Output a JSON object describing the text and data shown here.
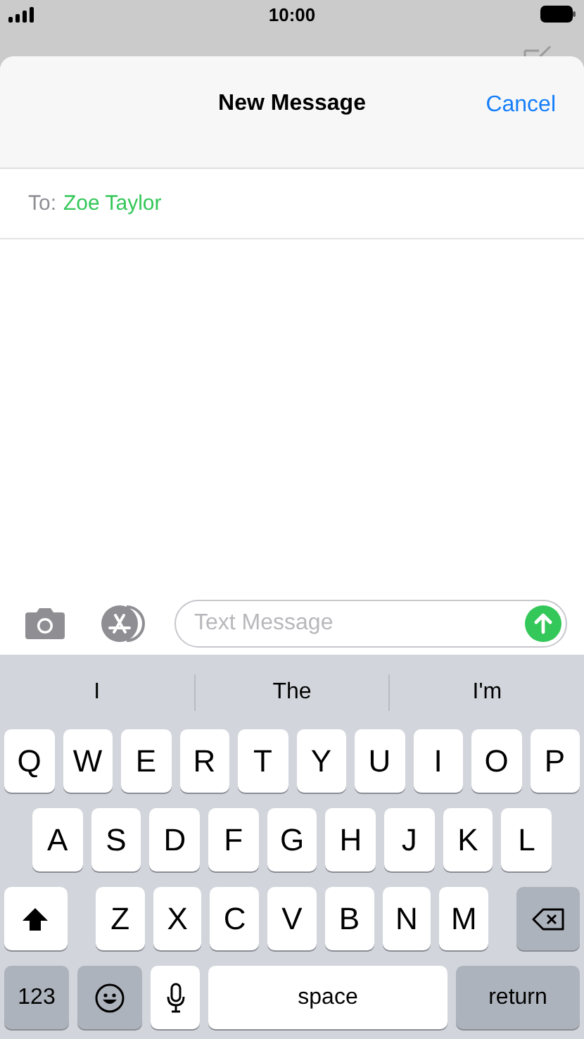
{
  "status_bar": {
    "time": "10:00"
  },
  "sheet": {
    "title": "New Message",
    "cancel": "Cancel",
    "to_label": "To:",
    "recipient": "Zoe Taylor"
  },
  "compose": {
    "placeholder": "Text Message"
  },
  "suggestions": [
    "I",
    "The",
    "I'm"
  ],
  "keyboard": {
    "letter_rows": [
      [
        {
          "kind": "letter",
          "label": "Q"
        },
        {
          "kind": "letter",
          "label": "W"
        },
        {
          "kind": "letter",
          "label": "E"
        },
        {
          "kind": "letter",
          "label": "R"
        },
        {
          "kind": "letter",
          "label": "T"
        },
        {
          "kind": "letter",
          "label": "Y"
        },
        {
          "kind": "letter",
          "label": "U"
        },
        {
          "kind": "letter",
          "label": "I"
        },
        {
          "kind": "letter",
          "label": "O"
        },
        {
          "kind": "letter",
          "label": "P"
        }
      ],
      [
        {
          "kind": "letter",
          "label": "A"
        },
        {
          "kind": "letter",
          "label": "S"
        },
        {
          "kind": "letter",
          "label": "D"
        },
        {
          "kind": "letter",
          "label": "F"
        },
        {
          "kind": "letter",
          "label": "G"
        },
        {
          "kind": "letter",
          "label": "H"
        },
        {
          "kind": "letter",
          "label": "J"
        },
        {
          "kind": "letter",
          "label": "K"
        },
        {
          "kind": "letter",
          "label": "L"
        }
      ],
      [
        {
          "kind": "shift"
        },
        {
          "kind": "letter",
          "label": "Z"
        },
        {
          "kind": "letter",
          "label": "X"
        },
        {
          "kind": "letter",
          "label": "C"
        },
        {
          "kind": "letter",
          "label": "V"
        },
        {
          "kind": "letter",
          "label": "B"
        },
        {
          "kind": "letter",
          "label": "N"
        },
        {
          "kind": "letter",
          "label": "M"
        },
        {
          "kind": "delete"
        }
      ]
    ],
    "bottom_row": [
      {
        "kind": "mode",
        "label": "123"
      },
      {
        "kind": "emoji"
      },
      {
        "kind": "mic"
      },
      {
        "kind": "space",
        "label": "space"
      },
      {
        "kind": "return",
        "label": "return"
      }
    ]
  }
}
